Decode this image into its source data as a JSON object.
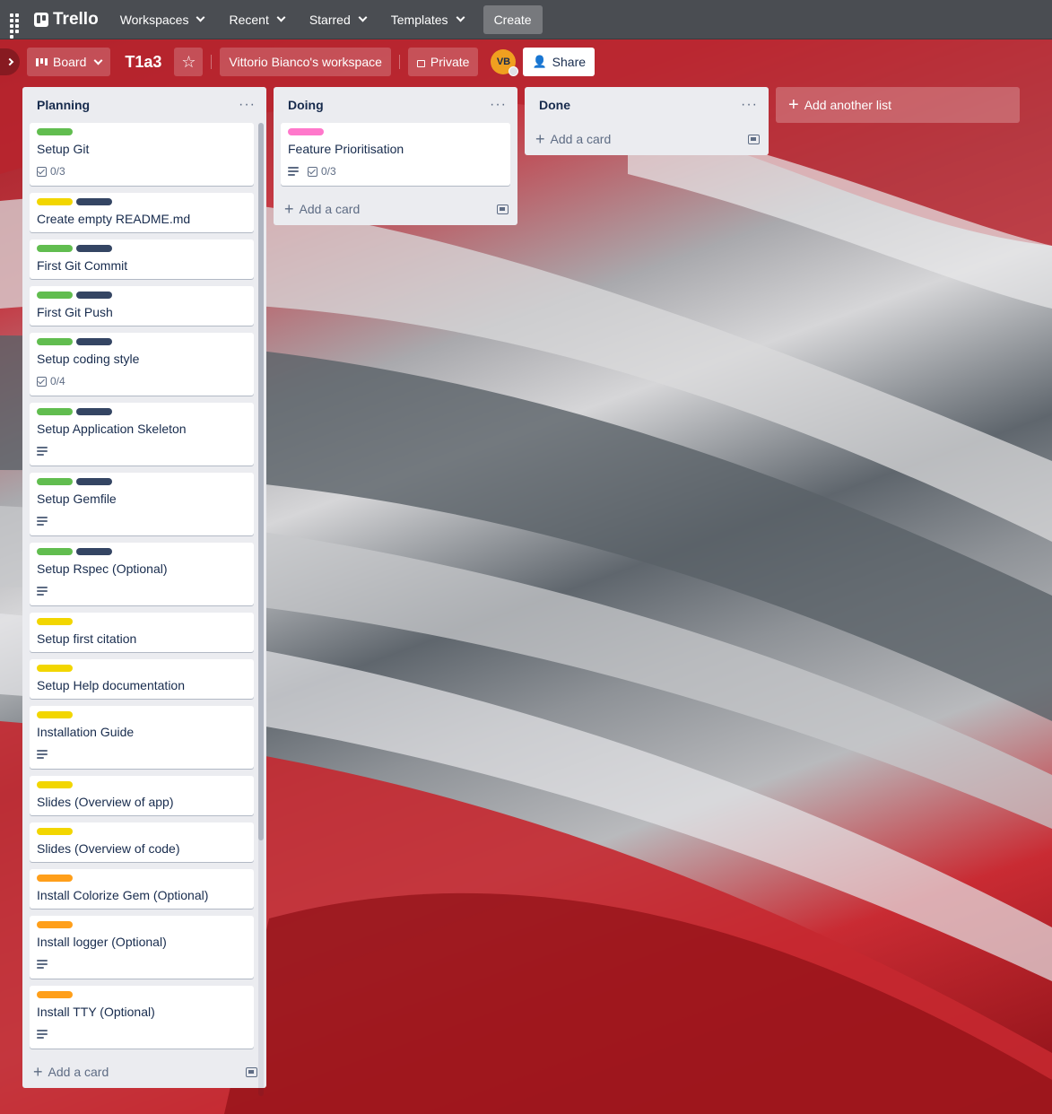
{
  "colors": {
    "nav_bg": "#4a4d52",
    "list_bg": "#ebecf0",
    "label_green": "#61bd4f",
    "label_navy": "#344563",
    "label_yellow": "#f2d600",
    "label_orange": "#ff9f1a",
    "label_pink": "#ff78cb"
  },
  "topnav": {
    "logo": "Trello",
    "menus": [
      "Workspaces",
      "Recent",
      "Starred",
      "Templates"
    ],
    "create": "Create"
  },
  "boardbar": {
    "view": "Board",
    "title": "T1a3",
    "workspace": "Vittorio Bianco's workspace",
    "visibility": "Private",
    "avatar_initials": "VB",
    "share": "Share"
  },
  "lists": [
    {
      "title": "Planning",
      "add_card": "Add a card",
      "cards": [
        {
          "title": "Setup Git",
          "labels": [
            "green"
          ],
          "checklist": "0/3"
        },
        {
          "title": "Create empty README.md",
          "labels": [
            "yellow",
            "navy"
          ]
        },
        {
          "title": "First Git Commit",
          "labels": [
            "green",
            "navy"
          ]
        },
        {
          "title": "First Git Push",
          "labels": [
            "green",
            "navy"
          ]
        },
        {
          "title": "Setup coding style",
          "labels": [
            "green",
            "navy"
          ],
          "checklist": "0/4"
        },
        {
          "title": "Setup Application Skeleton",
          "labels": [
            "green",
            "navy"
          ],
          "description": true
        },
        {
          "title": "Setup Gemfile",
          "labels": [
            "green",
            "navy"
          ],
          "description": true
        },
        {
          "title": "Setup Rspec (Optional)",
          "labels": [
            "green",
            "navy"
          ],
          "description": true
        },
        {
          "title": "Setup first citation",
          "labels": [
            "yellow"
          ]
        },
        {
          "title": "Setup Help documentation",
          "labels": [
            "yellow"
          ]
        },
        {
          "title": "Installation Guide",
          "labels": [
            "yellow"
          ],
          "description": true
        },
        {
          "title": "Slides (Overview of app)",
          "labels": [
            "yellow"
          ]
        },
        {
          "title": "Slides (Overview of code)",
          "labels": [
            "yellow"
          ]
        },
        {
          "title": "Install Colorize Gem (Optional)",
          "labels": [
            "orange"
          ]
        },
        {
          "title": "Install logger (Optional)",
          "labels": [
            "orange"
          ],
          "description": true
        },
        {
          "title": "Install TTY (Optional)",
          "labels": [
            "orange"
          ],
          "description": true
        }
      ]
    },
    {
      "title": "Doing",
      "add_card": "Add a card",
      "cards": [
        {
          "title": "Feature Prioritisation",
          "labels": [
            "pink"
          ],
          "description": true,
          "checklist": "0/3"
        }
      ]
    },
    {
      "title": "Done",
      "add_card": "Add a card",
      "cards": []
    }
  ],
  "add_list": "Add another list"
}
